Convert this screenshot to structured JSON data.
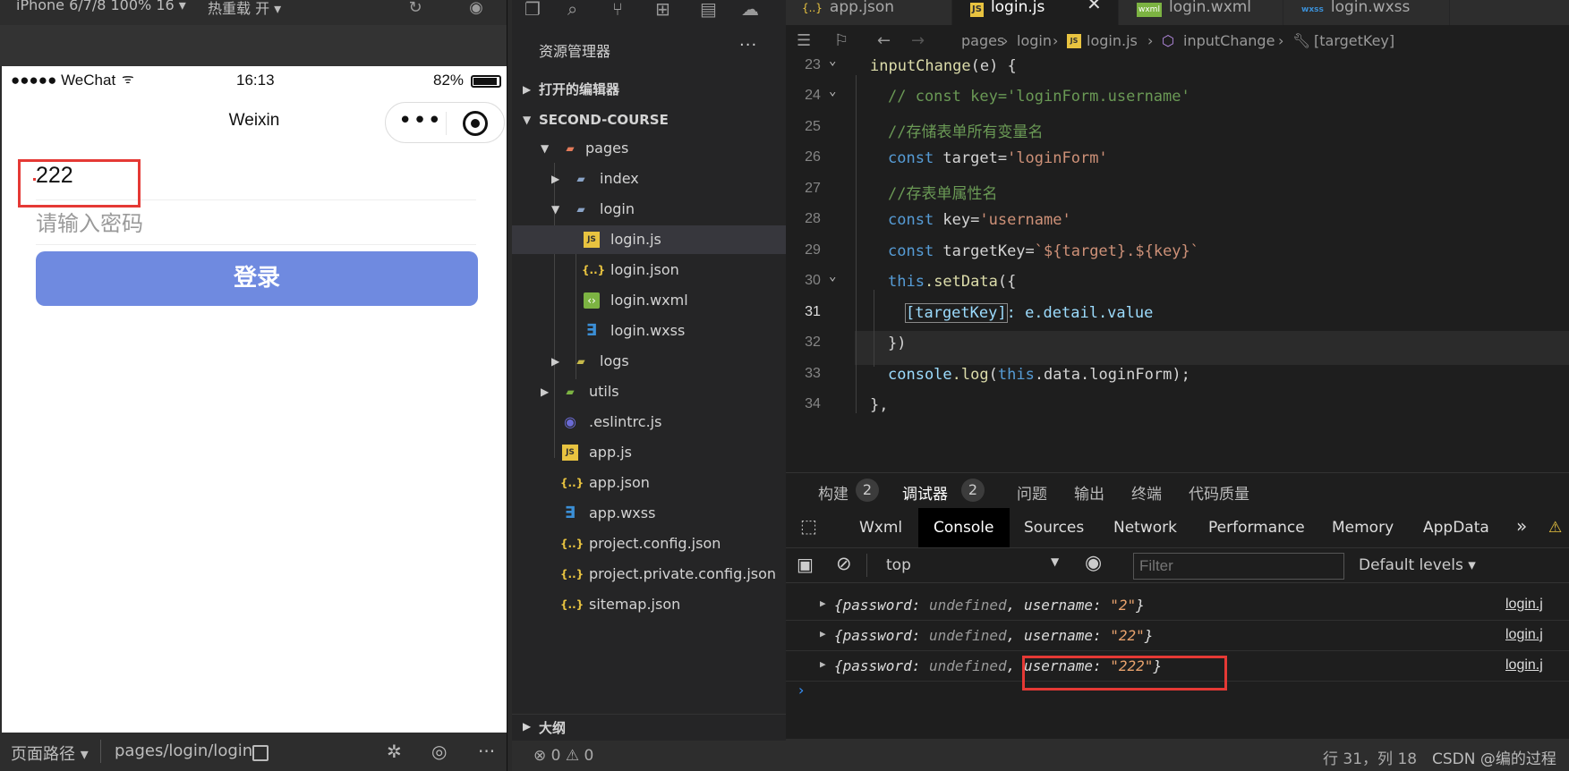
{
  "simulator": {
    "device_label": "iPhone 6/7/8 100% 16 ▾",
    "hotreload_label": "热重载 开 ▾",
    "status": {
      "carrier": "●●●●● WeChat",
      "time": "16:13",
      "battery": "82%"
    },
    "nav_title": "Weixin",
    "form": {
      "username_value": "222",
      "password_placeholder": "请输入密码",
      "login_label": "登录"
    },
    "footer": {
      "path_label": "页面路径 ▾",
      "path_value": "pages/login/login"
    }
  },
  "explorer": {
    "header": "资源管理器",
    "more": "···",
    "open_editors": "打开的编辑器",
    "project": "SECOND-COURSE",
    "tree": [
      {
        "label": "pages",
        "type": "folder-open"
      },
      {
        "label": "index",
        "type": "folder"
      },
      {
        "label": "login",
        "type": "folder-open"
      },
      {
        "label": "login.js",
        "type": "js",
        "selected": true
      },
      {
        "label": "login.json",
        "type": "json"
      },
      {
        "label": "login.wxml",
        "type": "wxml"
      },
      {
        "label": "login.wxss",
        "type": "wxss"
      },
      {
        "label": "logs",
        "type": "folder"
      },
      {
        "label": "utils",
        "type": "folder"
      },
      {
        "label": ".eslintrc.js",
        "type": "eslint"
      },
      {
        "label": "app.js",
        "type": "js"
      },
      {
        "label": "app.json",
        "type": "json"
      },
      {
        "label": "app.wxss",
        "type": "wxss"
      },
      {
        "label": "project.config.json",
        "type": "json"
      },
      {
        "label": "project.private.config.json",
        "type": "json"
      },
      {
        "label": "sitemap.json",
        "type": "json"
      }
    ],
    "outline": "大纲",
    "problems": "⊗ 0 ⚠ 0"
  },
  "editor": {
    "tabs": [
      {
        "label": "app.json",
        "icon": "{..}"
      },
      {
        "label": "login.js",
        "icon": "JS",
        "active": true
      },
      {
        "label": "login.wxml",
        "icon": "wxml"
      },
      {
        "label": "login.wxss",
        "icon": "wxss"
      }
    ],
    "breadcrumb": [
      "pages",
      "login",
      "login.js",
      "inputChange",
      "[targetKey]"
    ],
    "line_numbers": [
      "23",
      "24",
      "25",
      "26",
      "27",
      "28",
      "29",
      "30",
      "31",
      "32",
      "33",
      "34"
    ],
    "code": {
      "l23_fn": "inputChange",
      "l23_rest": "(e) {",
      "l24": "// const key='loginForm.username'",
      "l25": "//存储表单所有变量名",
      "l26_kw": "const",
      "l26_var": " target=",
      "l26_str": "'loginForm'",
      "l27": "//存表单属性名",
      "l28_kw": "const",
      "l28_var": " key=",
      "l28_str": "'username'",
      "l29_kw": "const",
      "l29_var": " targetKey=",
      "l29_str": "`${target}.${key}`",
      "l30_this": "this",
      "l30_fn": ".setData",
      "l30_rest": "({",
      "l31_key": "[targetKey]",
      "l31_rest": ": e.detail.value",
      "l32": "})",
      "l33_a": "console",
      "l33_fn": ".log",
      "l33_b": "(",
      "l33_this": "this",
      "l33_c": ".data.loginForm);",
      "l34": "},"
    },
    "debug_tabs": [
      {
        "label": "构建",
        "badge": "2"
      },
      {
        "label": "调试器",
        "badge": "2"
      },
      {
        "label": "问题"
      },
      {
        "label": "输出"
      },
      {
        "label": "终端"
      },
      {
        "label": "代码质量"
      }
    ],
    "devtools_tabs": [
      "Wxml",
      "Console",
      "Sources",
      "Network",
      "Performance",
      "Memory",
      "AppData"
    ],
    "console_context": "top",
    "filter_placeholder": "Filter",
    "levels_label": "Default levels ▾",
    "logs": [
      {
        "pre": "{password: ",
        "undef": "undefined",
        "mid": ", username: ",
        "val": "\"2\"",
        "post": "}",
        "src": "login.j"
      },
      {
        "pre": "{password: ",
        "undef": "undefined",
        "mid": ", username: ",
        "val": "\"22\"",
        "post": "}",
        "src": "login.j"
      },
      {
        "pre": "{password: ",
        "undef": "undefined",
        "mid": ", username: ",
        "val": "\"222\"",
        "post": "}",
        "src": "login.j"
      }
    ],
    "status_position": "行 31，列 18",
    "watermark": "CSDN @编的过程"
  },
  "colors": {
    "accent_button": "#6f8ae0",
    "highlight_box": "#e53935",
    "editor_bg": "#1e1e1e"
  }
}
